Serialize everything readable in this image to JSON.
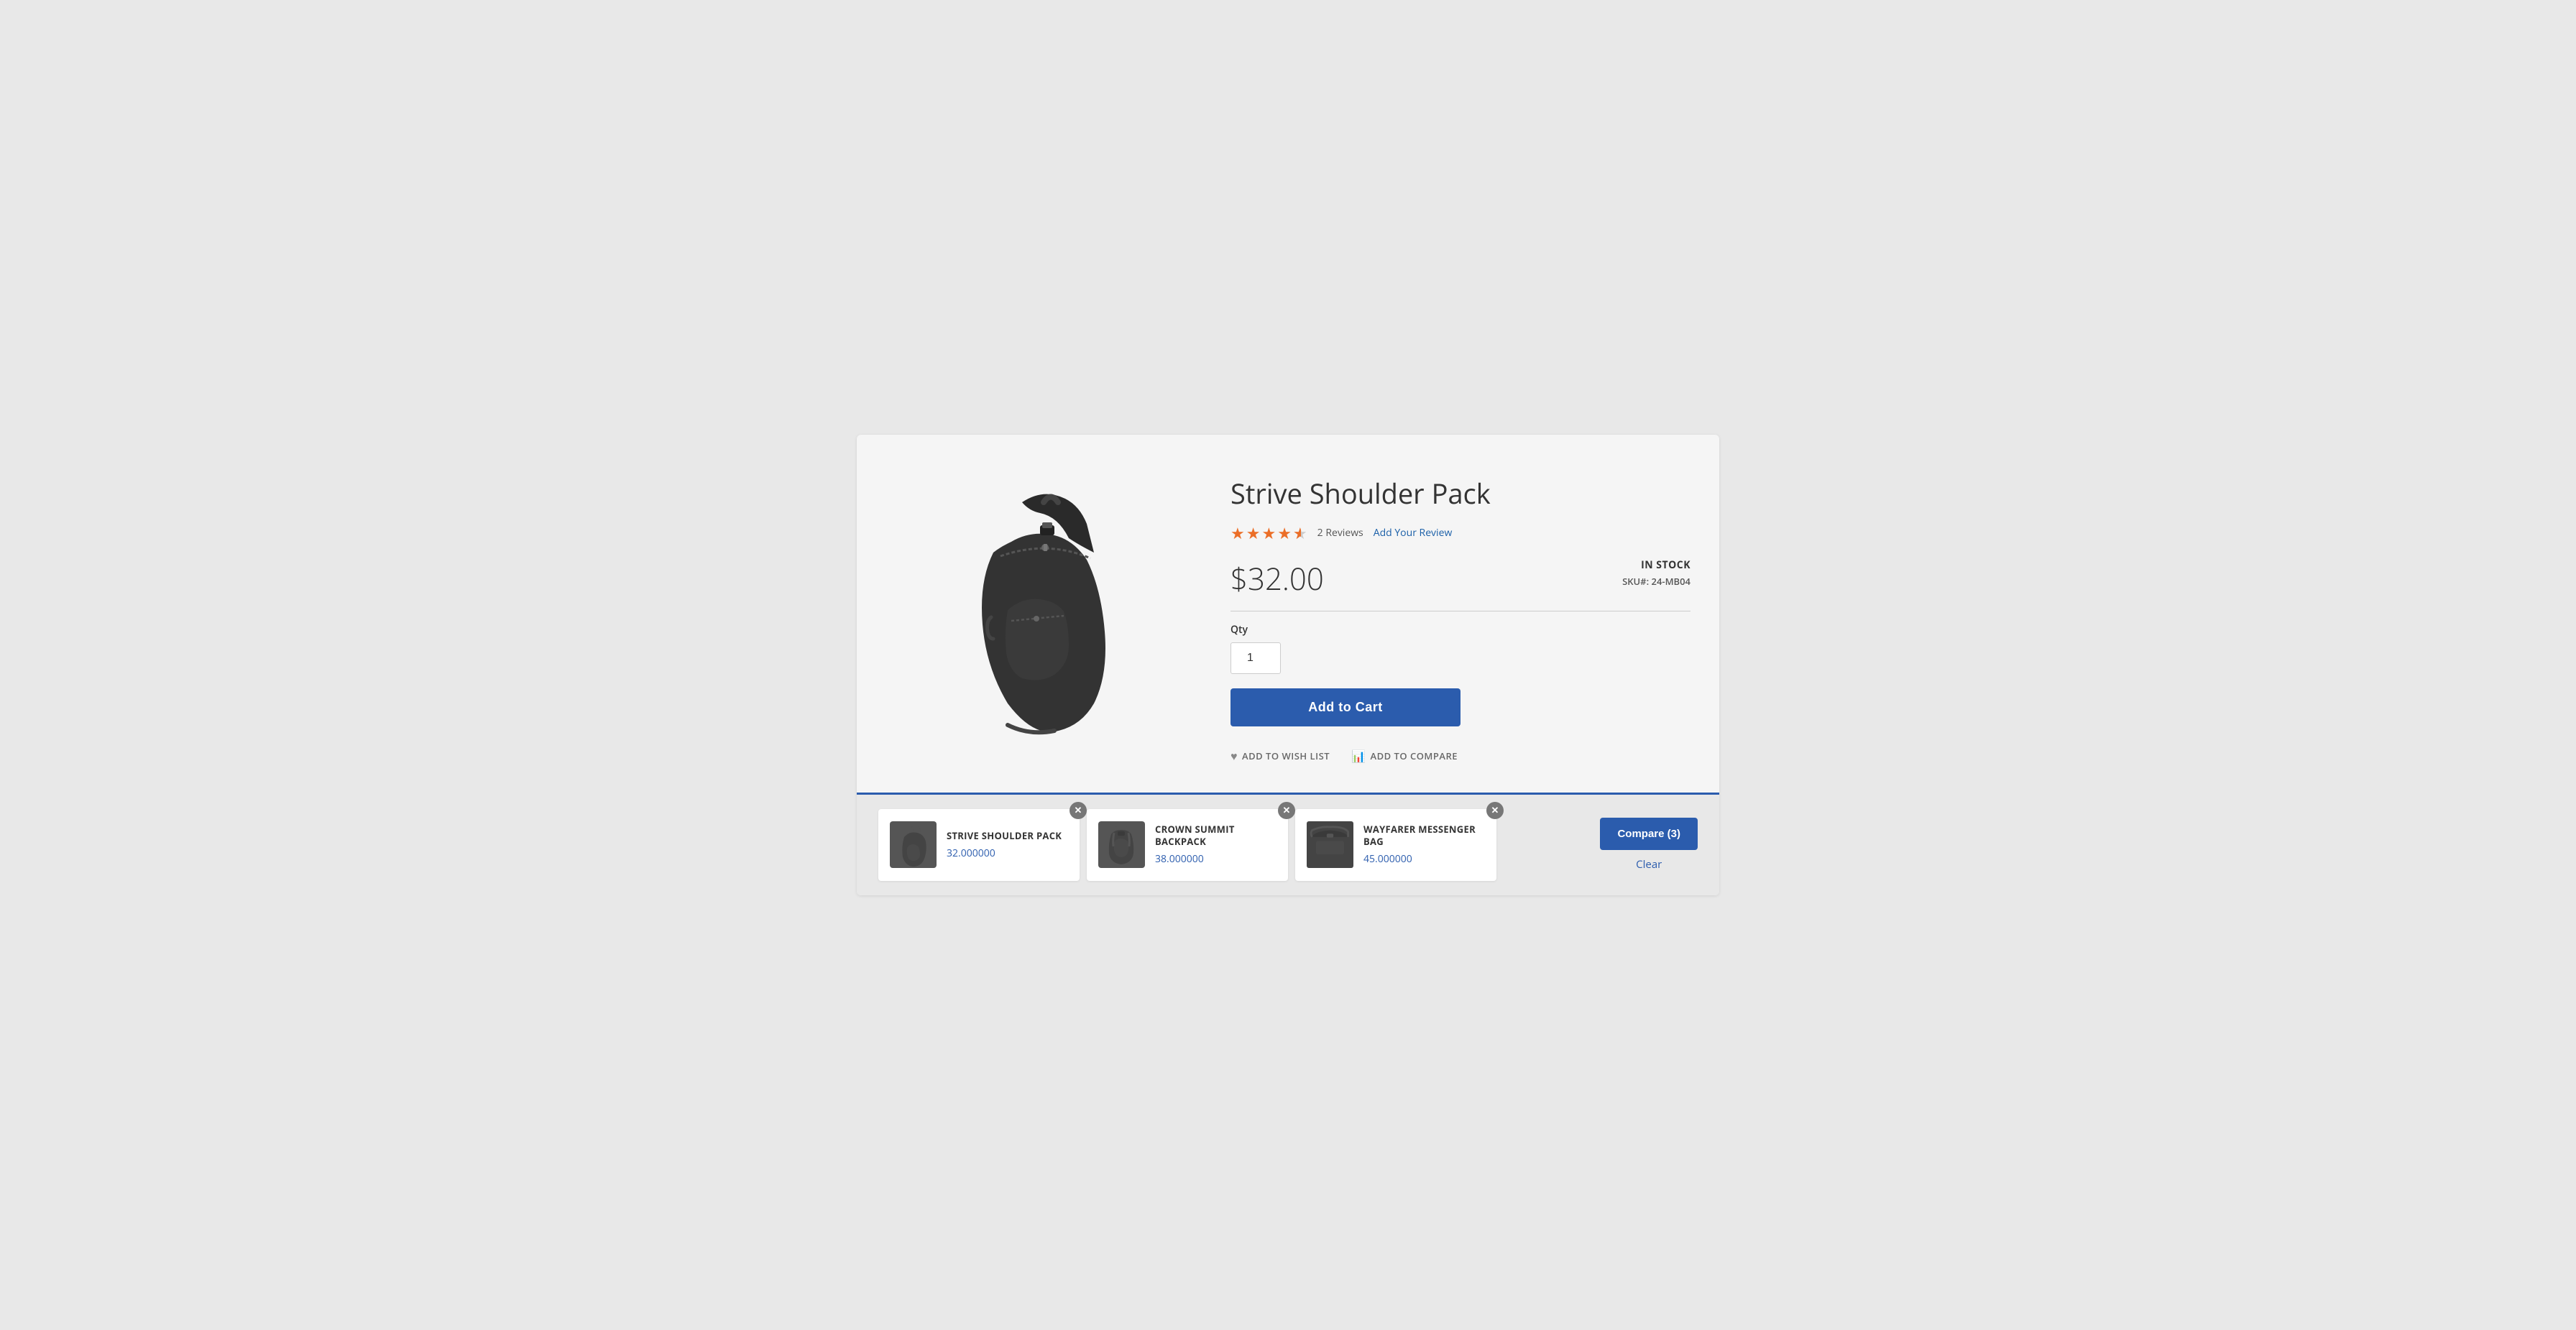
{
  "product": {
    "title": "Strive Shoulder Pack",
    "rating": 4.5,
    "rating_filled": 4,
    "rating_half": true,
    "reviews_count": "2  Reviews",
    "add_review_label": "Add Your Review",
    "price": "$32.00",
    "in_stock_label": "IN STOCK",
    "sku_label": "SKU#:",
    "sku_value": "24-MB04",
    "qty_label": "Qty",
    "qty_value": "1",
    "add_to_cart_label": "Add to Cart",
    "wish_list_label": "ADD TO WISH LIST",
    "compare_label": "ADD TO COMPARE"
  },
  "compare_bar": {
    "items": [
      {
        "name": "STRIVE SHOULDER PACK",
        "price": "32.000000",
        "type": "shoulder"
      },
      {
        "name": "CROWN SUMMIT BACKPACK",
        "price": "38.000000",
        "type": "backpack"
      },
      {
        "name": "WAYFARER MESSENGER BAG",
        "price": "45.000000",
        "type": "messenger"
      }
    ],
    "compare_button_label": "Compare (3)",
    "clear_label": "Clear"
  }
}
